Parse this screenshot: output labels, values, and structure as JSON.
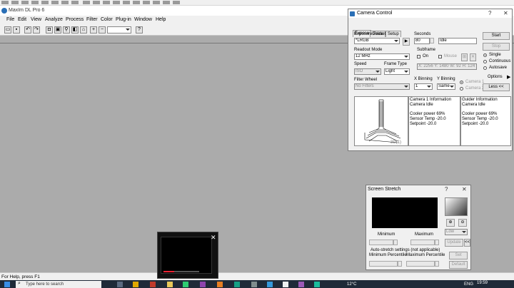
{
  "app": {
    "title": "MaxIm DL Pro 6"
  },
  "menu": [
    "File",
    "Edit",
    "View",
    "Analyze",
    "Process",
    "Filter",
    "Color",
    "Plug-in",
    "Window",
    "Help"
  ],
  "status": {
    "text": "For Help, press F1"
  },
  "taskbar": {
    "search_placeholder": "Type here to search",
    "temp": "12°C",
    "lang": "ENG",
    "time": "19:59"
  },
  "camera_control": {
    "title": "Camera Control",
    "help_glyph": "?",
    "close_glyph": "✕",
    "tabs": [
      "Expose",
      "Guide",
      "Setup"
    ],
    "exposure_preset_label": "Exposure Preset",
    "exposure_preset_value": "*LRGB",
    "seconds_label": "Seconds",
    "seconds_value": "80",
    "state_value": "Idle",
    "readout_label": "Readout Mode",
    "readout_value": "12 MHz",
    "subframe_label": "Subframe",
    "subframe_on": "On",
    "subframe_mouse": "Mouse",
    "subframe_coords": "X: 2256 Y: 1480 W: 92 H: 124",
    "speed_label": "Speed",
    "speed_value": "ISO",
    "frame_type_label": "Frame Type",
    "frame_type_value": "Light",
    "filter_wheel_label": "Filter Wheel",
    "filter_wheel_value": "No Filters",
    "x_binning_label": "X Binning",
    "x_binning_value": "1",
    "y_binning_label": "Y Binning",
    "y_binning_value": "Same",
    "camera1_radio": "Camera 1",
    "camera2_radio": "Camera 2",
    "start_button": "Start",
    "stop_button": "Stop",
    "mode_single": "Single",
    "mode_continuous": "Continuous",
    "mode_autosave": "Autosave",
    "options_button": "Options",
    "less_button": "Less <<",
    "plot_label": "3D(1)",
    "camera1_info": [
      "Camera 1 Information",
      "Camera Idle",
      "",
      "Cooler power 69%",
      "Sensor Temp -20.0",
      "Setpoint -20.0"
    ],
    "guider_info": [
      "Guider Information",
      "Camera Idle",
      "",
      "Cooler power 69%",
      "Sensor Temp -20.0",
      "Setpoint -20.0"
    ]
  },
  "screen_stretch": {
    "title": "Screen Stretch",
    "help_glyph": "?",
    "close_glyph": "✕",
    "minimum_label": "Minimum",
    "maximum_label": "Maximum",
    "low_value": "Low",
    "update_button": "Update",
    "expand_button": "<<",
    "auto_label": "Auto-stretch settings (not applicable)",
    "min_percentile_label": "Minimum Percentile",
    "max_percentile_label": "Maximum Percentile",
    "set_button": "Set",
    "default_button": "Default"
  },
  "video_overlay": {
    "close_glyph": "✕"
  }
}
